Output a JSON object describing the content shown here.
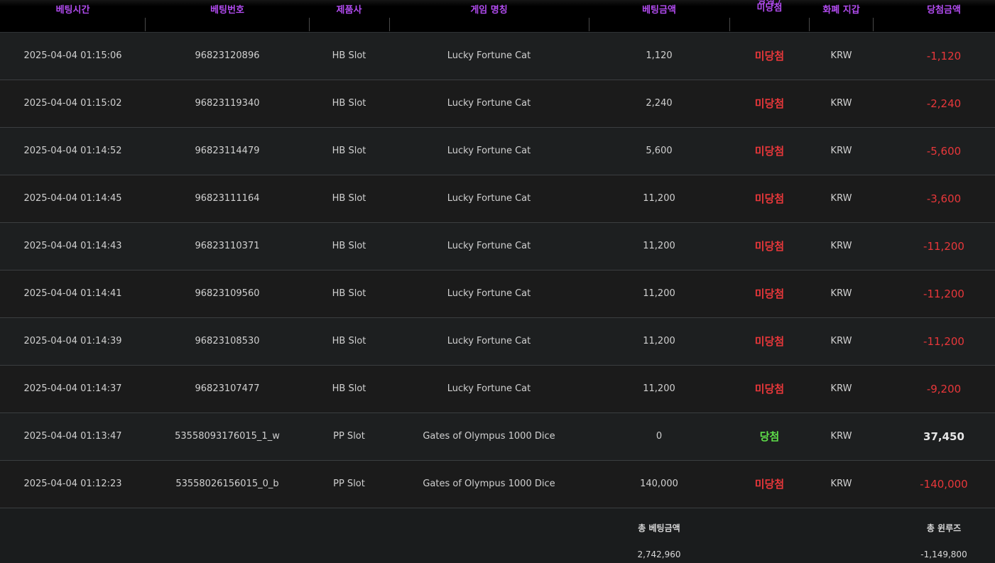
{
  "columns": [
    {
      "key": "time",
      "label": "베팅시간"
    },
    {
      "key": "bet_no",
      "label": "베팅번호"
    },
    {
      "key": "provider",
      "label": "제품사"
    },
    {
      "key": "game",
      "label": "게임 명칭"
    },
    {
      "key": "bet_amount",
      "label": "베팅금액"
    },
    {
      "key": "result",
      "label": "당첨 / 미당첨",
      "lines": [
        "당첨 /",
        "미당첨"
      ]
    },
    {
      "key": "wallet",
      "label": "화폐 지갑"
    },
    {
      "key": "win_amount",
      "label": "당첨금액"
    }
  ],
  "rows": [
    {
      "time": "2025-04-04 01:15:06",
      "bet_no": "96823120896",
      "provider": "HB Slot",
      "game": "Lucky Fortune Cat",
      "bet_amount": "1,120",
      "result": "미당첨",
      "wallet": "KRW",
      "win_amount": "-1,120",
      "won": false
    },
    {
      "time": "2025-04-04 01:15:02",
      "bet_no": "96823119340",
      "provider": "HB Slot",
      "game": "Lucky Fortune Cat",
      "bet_amount": "2,240",
      "result": "미당첨",
      "wallet": "KRW",
      "win_amount": "-2,240",
      "won": false
    },
    {
      "time": "2025-04-04 01:14:52",
      "bet_no": "96823114479",
      "provider": "HB Slot",
      "game": "Lucky Fortune Cat",
      "bet_amount": "5,600",
      "result": "미당첨",
      "wallet": "KRW",
      "win_amount": "-5,600",
      "won": false
    },
    {
      "time": "2025-04-04 01:14:45",
      "bet_no": "96823111164",
      "provider": "HB Slot",
      "game": "Lucky Fortune Cat",
      "bet_amount": "11,200",
      "result": "미당첨",
      "wallet": "KRW",
      "win_amount": "-3,600",
      "won": false
    },
    {
      "time": "2025-04-04 01:14:43",
      "bet_no": "96823110371",
      "provider": "HB Slot",
      "game": "Lucky Fortune Cat",
      "bet_amount": "11,200",
      "result": "미당첨",
      "wallet": "KRW",
      "win_amount": "-11,200",
      "won": false
    },
    {
      "time": "2025-04-04 01:14:41",
      "bet_no": "96823109560",
      "provider": "HB Slot",
      "game": "Lucky Fortune Cat",
      "bet_amount": "11,200",
      "result": "미당첨",
      "wallet": "KRW",
      "win_amount": "-11,200",
      "won": false
    },
    {
      "time": "2025-04-04 01:14:39",
      "bet_no": "96823108530",
      "provider": "HB Slot",
      "game": "Lucky Fortune Cat",
      "bet_amount": "11,200",
      "result": "미당첨",
      "wallet": "KRW",
      "win_amount": "-11,200",
      "won": false
    },
    {
      "time": "2025-04-04 01:14:37",
      "bet_no": "96823107477",
      "provider": "HB Slot",
      "game": "Lucky Fortune Cat",
      "bet_amount": "11,200",
      "result": "미당첨",
      "wallet": "KRW",
      "win_amount": "-9,200",
      "won": false
    },
    {
      "time": "2025-04-04 01:13:47",
      "bet_no": "53558093176015_1_w",
      "provider": "PP Slot",
      "game": "Gates of Olympus 1000 Dice",
      "bet_amount": "0",
      "result": "당첨",
      "wallet": "KRW",
      "win_amount": "37,450",
      "won": true
    },
    {
      "time": "2025-04-04 01:12:23",
      "bet_no": "53558026156015_0_b",
      "provider": "PP Slot",
      "game": "Gates of Olympus 1000 Dice",
      "bet_amount": "140,000",
      "result": "미당첨",
      "wallet": "KRW",
      "win_amount": "-140,000",
      "won": false
    }
  ],
  "totals": {
    "bet_label": "총 베팅금액",
    "bet_value": "2,742,960",
    "winloss_label": "총 윈루즈",
    "winloss_value": "-1,149,800"
  },
  "colors": {
    "header_text": "#b34cf2",
    "loss": "#e8373a",
    "win": "#5fde4a"
  }
}
